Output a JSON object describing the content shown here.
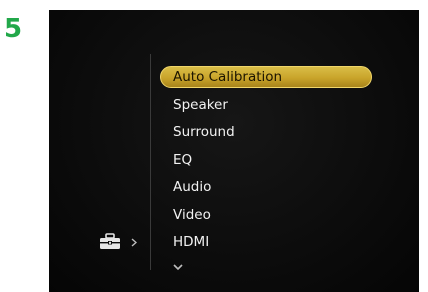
{
  "step": {
    "number": "5"
  },
  "setup_menu": {
    "items": [
      {
        "label": "Auto Calibration",
        "selected": true
      },
      {
        "label": "Speaker",
        "selected": false
      },
      {
        "label": "Surround",
        "selected": false
      },
      {
        "label": "EQ",
        "selected": false
      },
      {
        "label": "Audio",
        "selected": false
      },
      {
        "label": "Video",
        "selected": false
      },
      {
        "label": "HDMI",
        "selected": false
      }
    ]
  },
  "icons": {
    "category": "toolbox-icon",
    "category_arrow": "chevron-right-icon",
    "more_below": "chevron-down-icon"
  },
  "colors": {
    "step_number": "#22a84a",
    "screen_background": "#0b0b0b",
    "highlight": "#c9a42a",
    "menu_text": "#f2f2f2"
  }
}
